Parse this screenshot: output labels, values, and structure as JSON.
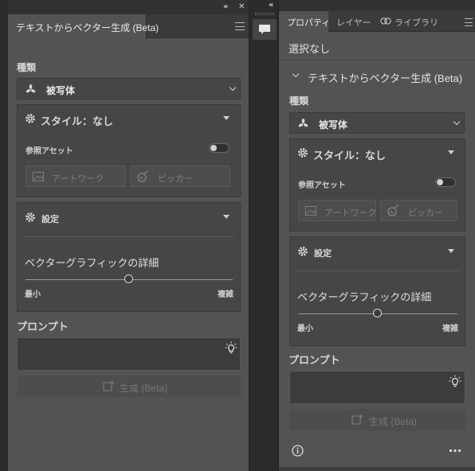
{
  "left_panel": {
    "window_controls": {
      "collapse": "«",
      "close": "✕"
    },
    "tab_title": "テキストからベクター生成 (Beta)",
    "type_label": "種類",
    "type_value": "被写体",
    "style_label": "スタイル：なし",
    "reference_asset_label": "参照アセット",
    "artwork_button": "アートワーク",
    "picker_button": "ピッカー",
    "settings_label": "設定",
    "detail_label": "ベクターグラフィックの詳細",
    "detail_min": "最小",
    "detail_max": "複雑",
    "detail_value": 0.5,
    "prompt_label": "プロンプト",
    "prompt_value": "",
    "generate_button": "生成 (Beta)"
  },
  "right_panel": {
    "collapse": "«",
    "tabs": [
      {
        "label": "プロパティ",
        "active": true
      },
      {
        "label": "レイヤー",
        "active": false
      },
      {
        "label": "ライブラリ",
        "active": false
      }
    ],
    "selection_status": "選択なし",
    "section_title": "テキストからベクター生成 (Beta)",
    "type_label": "種類",
    "type_value": "被写体",
    "style_label": "スタイル：なし",
    "reference_asset_label": "参照アセット",
    "artwork_button": "アートワーク",
    "picker_button": "ピッカー",
    "settings_label": "設定",
    "detail_label": "ベクターグラフィックの詳細",
    "detail_min": "最小",
    "detail_max": "複雑",
    "detail_value": 0.5,
    "prompt_label": "プロンプト",
    "prompt_value": "",
    "generate_button": "生成 (Beta)"
  },
  "colors": {
    "panel_bg": "#535353",
    "section_bg": "#464646",
    "dark_bg": "#323232",
    "text": "#d6d6d6",
    "disabled_text": "#777777"
  }
}
